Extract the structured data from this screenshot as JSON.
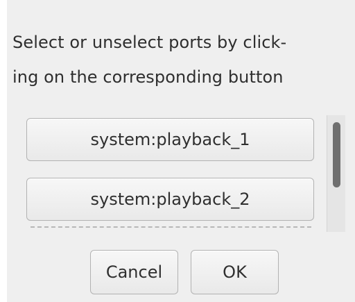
{
  "dialog": {
    "instruction_line1": "Select or unselect ports by click-",
    "instruction_line2": "ing on the corresponding button"
  },
  "ports": [
    {
      "label": "system:playback_1"
    },
    {
      "label": "system:playback_2"
    }
  ],
  "scrollbar": {
    "position_fraction": 0.0
  },
  "actions": {
    "cancel_label": "Cancel",
    "ok_label": "OK"
  },
  "colors": {
    "dialog_background": "#efefef",
    "button_border": "#b2b2b2",
    "scroll_thumb": "#6f6f6f"
  }
}
